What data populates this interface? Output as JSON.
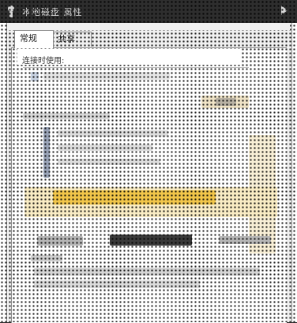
{
  "window": {
    "title": "本地磁盘 属性"
  },
  "tabs": [
    {
      "label": "常规"
    },
    {
      "label": "共享"
    }
  ],
  "content": {
    "first_label": "连接时使用:"
  },
  "colors": {
    "titlebar": "#2e2e2e",
    "yellow_band": "#f2c64a",
    "dark_bar": "#3a3a3a"
  }
}
